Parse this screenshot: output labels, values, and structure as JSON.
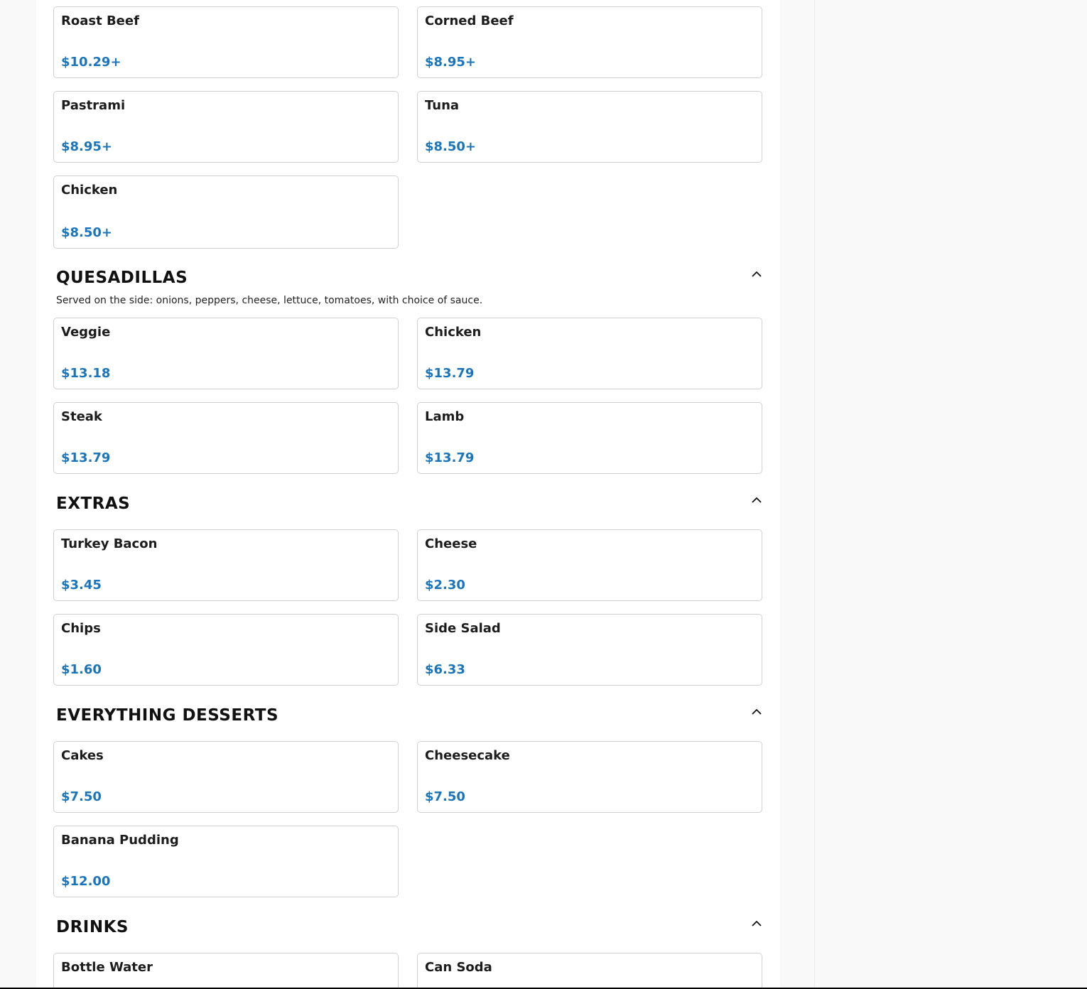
{
  "sections": {
    "sandwiches": {
      "items": [
        {
          "name": "Roast Beef",
          "price": "$10.29+"
        },
        {
          "name": "Corned Beef",
          "price": "$8.95+"
        },
        {
          "name": "Pastrami",
          "price": "$8.95+"
        },
        {
          "name": "Tuna",
          "price": "$8.50+"
        },
        {
          "name": "Chicken",
          "price": "$8.50+"
        }
      ]
    },
    "quesadillas": {
      "title": "QUESADILLAS",
      "description": "Served on the side: onions, peppers, cheese, lettuce, tomatoes, with choice of sauce.",
      "items": [
        {
          "name": "Veggie",
          "price": "$13.18"
        },
        {
          "name": "Chicken",
          "price": "$13.79"
        },
        {
          "name": "Steak",
          "price": "$13.79"
        },
        {
          "name": "Lamb",
          "price": "$13.79"
        }
      ]
    },
    "extras": {
      "title": "EXTRAS",
      "items": [
        {
          "name": "Turkey Bacon",
          "price": "$3.45"
        },
        {
          "name": "Cheese",
          "price": "$2.30"
        },
        {
          "name": "Chips",
          "price": "$1.60"
        },
        {
          "name": "Side Salad",
          "price": "$6.33"
        }
      ]
    },
    "desserts": {
      "title": "EVERYTHING DESSERTS",
      "items": [
        {
          "name": "Cakes",
          "price": "$7.50"
        },
        {
          "name": "Cheesecake",
          "price": "$7.50"
        },
        {
          "name": "Banana Pudding",
          "price": "$12.00"
        }
      ]
    },
    "drinks": {
      "title": "DRINKS",
      "items": [
        {
          "name": "Bottle Water"
        },
        {
          "name": "Can Soda"
        }
      ]
    }
  },
  "icons": {
    "collapse": "chevron-up-icon"
  },
  "colors": {
    "price": "#1b75bc",
    "card_border": "#d0d0d0",
    "page_bg": "#f9f9f9"
  }
}
